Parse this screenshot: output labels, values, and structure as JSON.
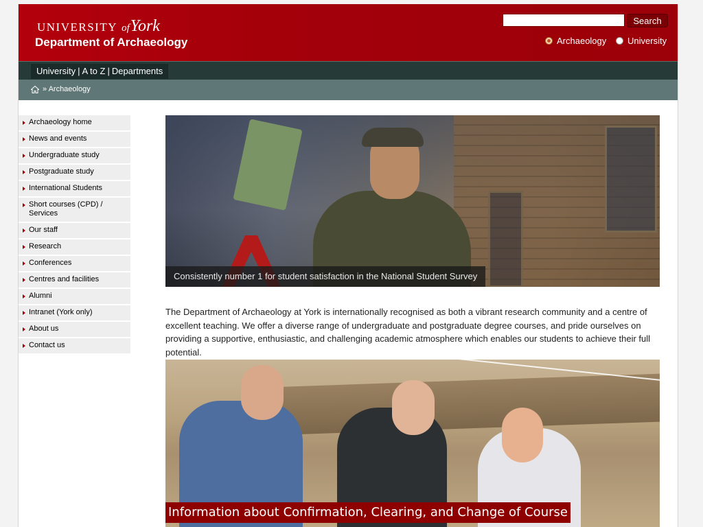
{
  "header": {
    "wordmark_university": "UNIVERSITY",
    "wordmark_of": "of",
    "wordmark_york": "York",
    "department": "Department of Archaeology",
    "search": {
      "value": "",
      "button_label": "Search"
    },
    "scope_options": [
      {
        "label": "Archaeology",
        "selected": true
      },
      {
        "label": "University",
        "selected": false
      }
    ]
  },
  "utility_nav": {
    "items": [
      "University",
      "A to Z",
      "Departments"
    ],
    "separator": "|"
  },
  "breadcrumb": {
    "icon": "home-icon",
    "current": "» Archaeology"
  },
  "sidebar": {
    "items": [
      {
        "label": "Archaeology home"
      },
      {
        "label": "News and events"
      },
      {
        "label": "Undergraduate study"
      },
      {
        "label": "Postgraduate study"
      },
      {
        "label": "International Students"
      },
      {
        "label": "Short courses (CPD) / Services"
      },
      {
        "label": "Our staff"
      },
      {
        "label": "Research"
      },
      {
        "label": "Conferences"
      },
      {
        "label": "Centres and facilities"
      },
      {
        "label": "Alumni"
      },
      {
        "label": "Intranet (York only)"
      },
      {
        "label": "About us"
      },
      {
        "label": "Contact us"
      }
    ]
  },
  "main": {
    "hero_caption": "Consistently number 1 for student satisfaction in the National Student Survey",
    "intro": "The Department of Archaeology at York is internationally recognised as both a vibrant research community and a centre of excellent teaching. We offer a diverse range of undergraduate and postgraduate degree courses, and pride ourselves on providing a supportive, enthusiastic, and challenging academic atmosphere which enables our students to achieve their full potential.",
    "promo_caption": "Information about Confirmation, Clearing, and Change of Course"
  },
  "colors": {
    "header_red": "#a50009",
    "utility_bar": "#263a37",
    "breadcrumb_bar": "#5f7776",
    "nav_arrow": "#a10000",
    "promo_caption_bg": "#8e0000"
  }
}
